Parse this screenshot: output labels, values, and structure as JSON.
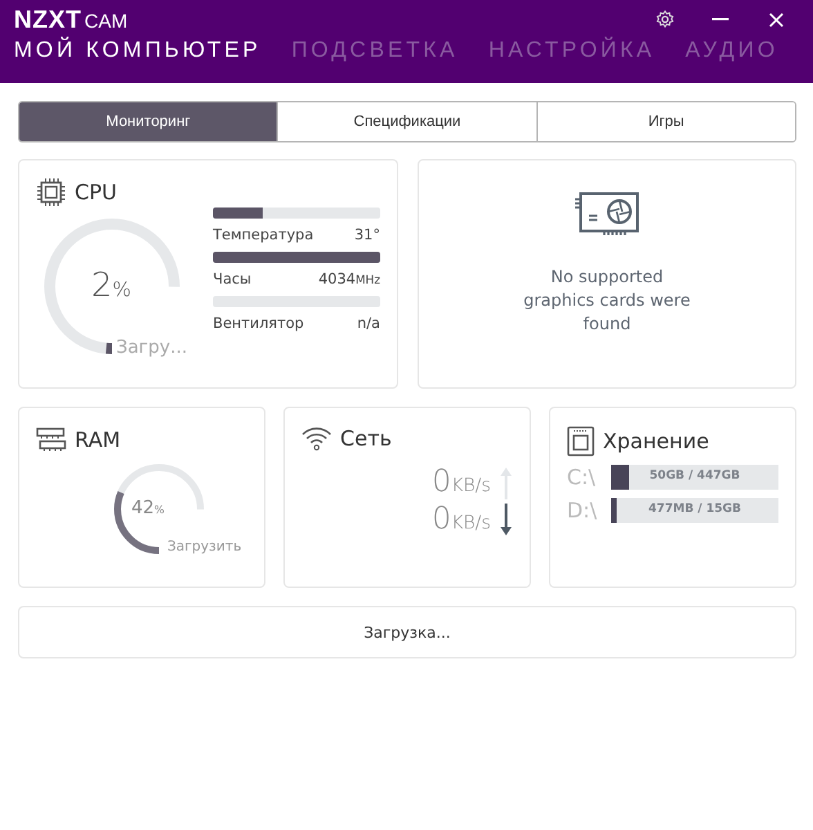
{
  "header": {
    "logo": "NZXT",
    "logo_suffix": "CAM",
    "nav": [
      {
        "label": "МОЙ КОМПЬЮТЕР",
        "selected": true
      },
      {
        "label": "ПОДСВЕТКА",
        "selected": false
      },
      {
        "label": "НАСТРОЙКА",
        "selected": false
      },
      {
        "label": "АУДИО",
        "selected": false
      }
    ]
  },
  "tabs": [
    {
      "label": "Мониторинг",
      "selected": true
    },
    {
      "label": "Спецификации",
      "selected": false
    },
    {
      "label": "Игры",
      "selected": false
    }
  ],
  "cpu": {
    "title": "CPU",
    "level": 0.02,
    "value": "2",
    "unit": "%",
    "gauge_label": "Загру...",
    "stats": [
      {
        "label": "Температура",
        "reading": "31°",
        "level": 0.3
      },
      {
        "label": "Часы",
        "reading": "4034",
        "unit": "MHz",
        "level": 1.0
      },
      {
        "label": "Вентилятор",
        "reading": "n/a"
      }
    ]
  },
  "gpu": {
    "message": "No supported graphics cards were found"
  },
  "ram": {
    "title": "RAM",
    "level": 0.42,
    "value": "42",
    "unit": "%",
    "gauge_label": "Загрузить"
  },
  "network": {
    "title": "Сеть",
    "rates": [
      {
        "kind": "up",
        "value": "0",
        "unit": "KB/s",
        "active": false
      },
      {
        "kind": "down",
        "value": "0",
        "unit": "KB/s",
        "active": true
      }
    ]
  },
  "storage": {
    "title": "Хранение",
    "drives": [
      {
        "name": "C:\\",
        "usage": "50GB / 447GB",
        "level": 0.11
      },
      {
        "name": "D:\\",
        "usage": "477MB / 15GB",
        "level": 0.03
      }
    ]
  },
  "loading": "Загрузка..."
}
